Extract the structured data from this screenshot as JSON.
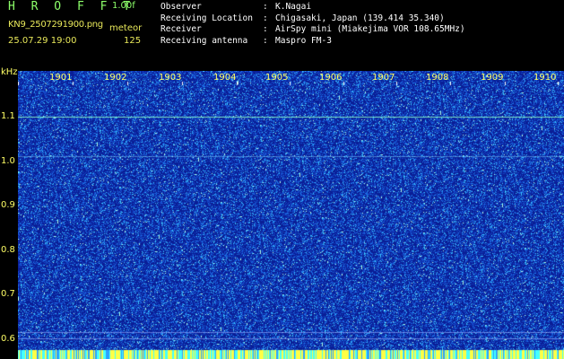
{
  "header": {
    "app_title": "H R O F F T",
    "version": "1.00f",
    "filename": "KN9_2507291900.png",
    "mode": "meteor",
    "datetime": "25.07.29 19:00",
    "count": "125"
  },
  "info": [
    {
      "key": "Observer",
      "sep": ":",
      "value": "K.Nagai"
    },
    {
      "key": "Receiving Location",
      "sep": ":",
      "value": "Chigasaki, Japan (139.414 35.340)"
    },
    {
      "key": "Receiver",
      "sep": ":",
      "value": "AirSpy mini (Miakejima VOR 108.65MHz)"
    },
    {
      "key": "Receiving antenna",
      "sep": ":",
      "value": "Maspro FM-3"
    }
  ],
  "axis": {
    "unit": "kHz",
    "y_labels": [
      "1.1",
      "1.0",
      "0.9",
      "0.8",
      "0.7",
      "0.6"
    ],
    "time_labels": [
      "1901",
      "1902",
      "1903",
      "1904",
      "1905",
      "1906",
      "1907",
      "1908",
      "1909",
      "1910"
    ]
  },
  "colors": {
    "background": "#0a1a9a",
    "noise": "#1e6cff",
    "signal": "#7fffd0",
    "label": "#ffff66",
    "title": "#8dff6a"
  }
}
